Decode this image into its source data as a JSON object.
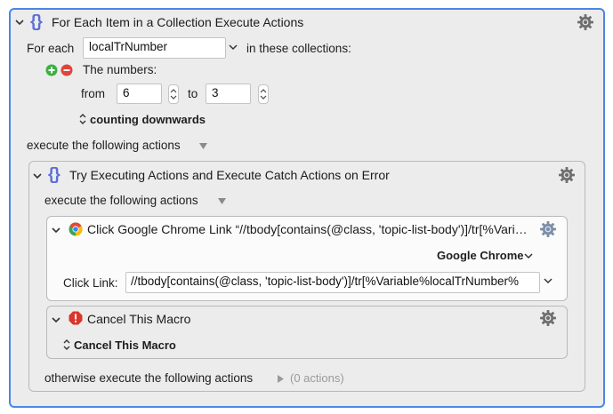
{
  "outer": {
    "title": "For Each Item in a Collection Execute Actions",
    "for_each_label": "For each",
    "variable_value": "localTrNumber",
    "collections_label": "in these collections:",
    "numbers_label": "The numbers:",
    "from_label": "from",
    "from_value": "6",
    "to_label": "to",
    "to_value": "3",
    "direction": "counting downwards",
    "execute_label": "execute the following actions"
  },
  "try_block": {
    "title": "Try Executing Actions and Execute Catch Actions on Error",
    "execute_label": "execute the following actions",
    "otherwise_label": "otherwise execute the following actions",
    "otherwise_count": "(0 actions)"
  },
  "chrome_action": {
    "title": "Click Google Chrome Link “//tbody[contains(@class, 'topic-list-body')]/tr[%Vari…",
    "browser": "Google Chrome",
    "click_link_label": "Click Link:",
    "click_link_value": "//tbody[contains(@class, 'topic-list-body')]/tr[%Variable%localTrNumber%"
  },
  "cancel_action": {
    "title": "Cancel This Macro",
    "option": "Cancel This Macro"
  },
  "colors": {
    "selection_border": "#4a86e8",
    "accent_braces": "#5b6fd6",
    "add_green": "#3cb043",
    "remove_red": "#e0443c"
  },
  "icons": [
    "chevron-down-icon",
    "braces-icon",
    "gear-icon",
    "add-icon",
    "remove-icon",
    "stepper-icon",
    "updown-icon",
    "triangle-down-icon",
    "triangle-right-icon",
    "chrome-icon",
    "stop-icon"
  ]
}
